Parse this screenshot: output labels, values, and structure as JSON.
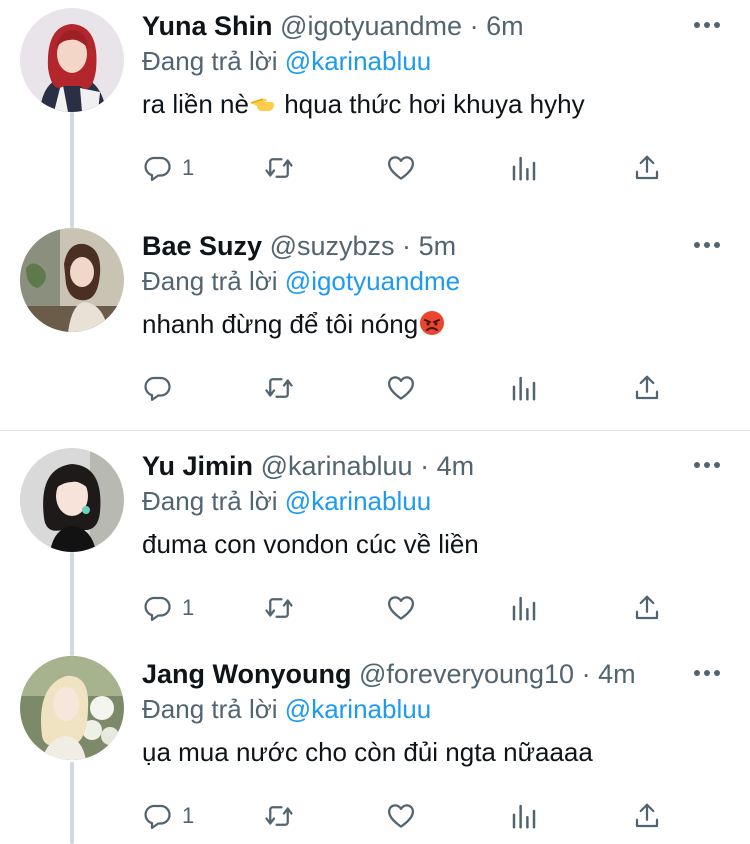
{
  "tweets": [
    {
      "name": "Yuna Shin",
      "handle": "@igotyuandme",
      "dot": "·",
      "time": "6m",
      "reply_prefix": "Đang trả lời",
      "reply_to": "@karinabluu",
      "text": "ra liền nè",
      "text_emoji": "pointing-hand-emoji",
      "text_after": " hqua thức hơi khuya hyhy",
      "reply_count": "1"
    },
    {
      "name": "Bae Suzy",
      "handle": "@suzybzs",
      "dot": "·",
      "time": "5m",
      "reply_prefix": "Đang trả lời",
      "reply_to": "@igotyuandme",
      "text": "nhanh đừng để tôi nóng",
      "text_emoji": "angry-face-emoji",
      "text_after": "",
      "reply_count": ""
    },
    {
      "name": "Yu Jimin",
      "handle": "@karinabluu",
      "dot": "·",
      "time": "4m",
      "reply_prefix": "Đang trả lời",
      "reply_to": "@karinabluu",
      "text": "đuma con vondon cúc về liền",
      "text_emoji": "",
      "text_after": "",
      "reply_count": "1"
    },
    {
      "name": "Jang Wonyoung",
      "handle": "@foreveryoung10",
      "dot": "·",
      "time": "4m",
      "reply_prefix": "Đang trả lời",
      "reply_to": "@karinabluu",
      "text": "ụa mua nước cho còn đủi ngta nữaaaa",
      "text_emoji": "",
      "text_after": "",
      "reply_count": "1"
    }
  ],
  "icons": {
    "reply": "reply-icon",
    "retweet": "retweet-icon",
    "like": "heart-icon",
    "analytics": "analytics-icon",
    "share": "share-icon",
    "more": "more-icon"
  },
  "colors": {
    "name": "#0f1419",
    "muted": "#536471",
    "mention": "#1d9bf0",
    "thread_line": "#cfd9de",
    "divider": "#e1e6ea"
  }
}
